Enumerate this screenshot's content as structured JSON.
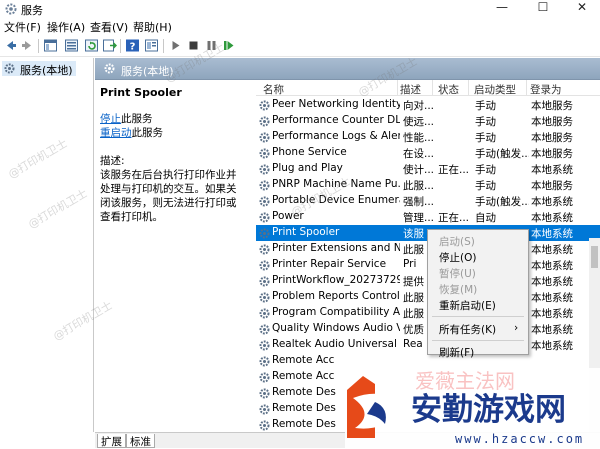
{
  "window": {
    "title": "服务",
    "minimize_label": "—",
    "maximize_label": "☐",
    "close_label": "✕"
  },
  "menubar": {
    "items": [
      "文件(F)",
      "操作(A)",
      "查看(V)",
      "帮助(H)"
    ]
  },
  "toolbar": {
    "icons": [
      "back-icon",
      "forward-icon",
      "console-tree-icon",
      "show-hide-icon",
      "refresh-icon",
      "export-icon",
      "help-icon",
      "properties-icon",
      "start-service-icon",
      "stop-service-icon",
      "pause-service-icon",
      "restart-service-icon"
    ]
  },
  "tree": {
    "item_label": "服务(本地)"
  },
  "pane": {
    "header_title": "服务(本地)"
  },
  "description": {
    "service_name": "Print Spooler",
    "stop_link": "停止",
    "stop_suffix": "此服务",
    "restart_link": "重启动",
    "restart_suffix": "此服务",
    "desc_label": "描述:",
    "desc_text": "该服务在后台执行打印作业并处理与打印机的交互。如果关闭该服务，则无法进行打印或查看打印机。"
  },
  "table": {
    "columns": [
      "名称",
      "描述",
      "状态",
      "启动类型",
      "登录为"
    ],
    "rows": [
      {
        "name": "Peer Networking Identity...",
        "desc": "向对...",
        "status": "",
        "startup": "手动",
        "logon": "本地服务"
      },
      {
        "name": "Performance Counter DL...",
        "desc": "使远...",
        "status": "",
        "startup": "手动",
        "logon": "本地服务"
      },
      {
        "name": "Performance Logs & Aler...",
        "desc": "性能...",
        "status": "",
        "startup": "手动",
        "logon": "本地服务"
      },
      {
        "name": "Phone Service",
        "desc": "在设...",
        "status": "",
        "startup": "手动(触发...",
        "logon": "本地服务"
      },
      {
        "name": "Plug and Play",
        "desc": "使计...",
        "status": "正在...",
        "startup": "手动",
        "logon": "本地系统"
      },
      {
        "name": "PNRP Machine Name Pu...",
        "desc": "此服...",
        "status": "",
        "startup": "手动",
        "logon": "本地服务"
      },
      {
        "name": "Portable Device Enumera...",
        "desc": "强制...",
        "status": "",
        "startup": "手动(触发...",
        "logon": "本地系统"
      },
      {
        "name": "Power",
        "desc": "管理...",
        "status": "正在...",
        "startup": "自动",
        "logon": "本地系统"
      },
      {
        "name": "Print Spooler",
        "desc": "该服",
        "status": "",
        "startup": "",
        "logon": "本地系统"
      },
      {
        "name": "Printer Extensions and N...",
        "desc": "此服",
        "status": "",
        "startup": "",
        "logon": "本地系统"
      },
      {
        "name": "Printer Repair Service",
        "desc": "Pri",
        "status": "",
        "startup": "",
        "logon": "本地系统"
      },
      {
        "name": "PrintWorkflow_20273729",
        "desc": "提供",
        "status": "",
        "startup": "",
        "logon": "本地系统"
      },
      {
        "name": "Problem Reports Control...",
        "desc": "此服",
        "status": "",
        "startup": "",
        "logon": "本地系统"
      },
      {
        "name": "Program Compatibility A...",
        "desc": "此服",
        "status": "",
        "startup": "",
        "logon": "本地系统"
      },
      {
        "name": "Quality Windows Audio V...",
        "desc": "优质",
        "status": "",
        "startup": "",
        "logon": "本地系统"
      },
      {
        "name": "Realtek Audio Universal ...",
        "desc": "Rea",
        "status": "",
        "startup": "",
        "logon": "本地系统"
      },
      {
        "name": "Remote Acc",
        "desc": "",
        "status": "",
        "startup": "",
        "logon": ""
      },
      {
        "name": "Remote Acc",
        "desc": "",
        "status": "",
        "startup": "",
        "logon": ""
      },
      {
        "name": "Remote Des",
        "desc": "",
        "status": "",
        "startup": "",
        "logon": ""
      },
      {
        "name": "Remote Des",
        "desc": "",
        "status": "",
        "startup": "",
        "logon": ""
      },
      {
        "name": "Remote Des",
        "desc": "",
        "status": "",
        "startup": "",
        "logon": ""
      }
    ]
  },
  "context_menu": {
    "start": "启动(S)",
    "stop": "停止(O)",
    "pause": "暂停(U)",
    "resume": "恢复(M)",
    "restart": "重新启动(E)",
    "all_tasks": "所有任务(K)",
    "all_tasks_arrow": "›",
    "refresh": "刷新(F)"
  },
  "tabs": [
    "扩展",
    "标准"
  ],
  "watermarks": [
    "@打印机卫士"
  ],
  "overlay_logo": {
    "text": "安勤游戏网",
    "url": "www.hzaccw.com",
    "partial_text": "爱薇主法网"
  },
  "colors": {
    "selection": "#0078d7",
    "header_gradient": "#9fb3c9",
    "link": "#0a63c8"
  }
}
